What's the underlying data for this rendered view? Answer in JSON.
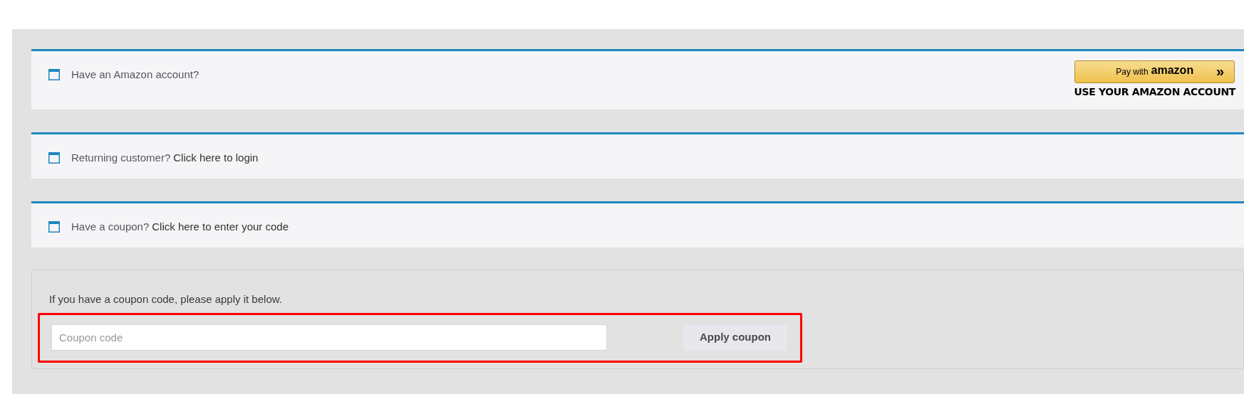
{
  "notices": [
    {
      "kind": "amazon",
      "prompt": "Have an Amazon account?",
      "pay_button": {
        "label": "Pay with",
        "brand": "amazon",
        "arrows": "»"
      },
      "caption": "USE YOUR AMAZON ACCOUNT"
    },
    {
      "kind": "link",
      "prompt": "Returning customer?",
      "link": "Click here to login"
    },
    {
      "kind": "link",
      "prompt": "Have a coupon?",
      "link": "Click here to enter your code"
    }
  ],
  "coupon_form": {
    "instructions": "If you have a coupon code, please apply it below.",
    "field": {
      "placeholder": "Coupon code"
    },
    "button": "Apply coupon",
    "highlighted": true
  }
}
